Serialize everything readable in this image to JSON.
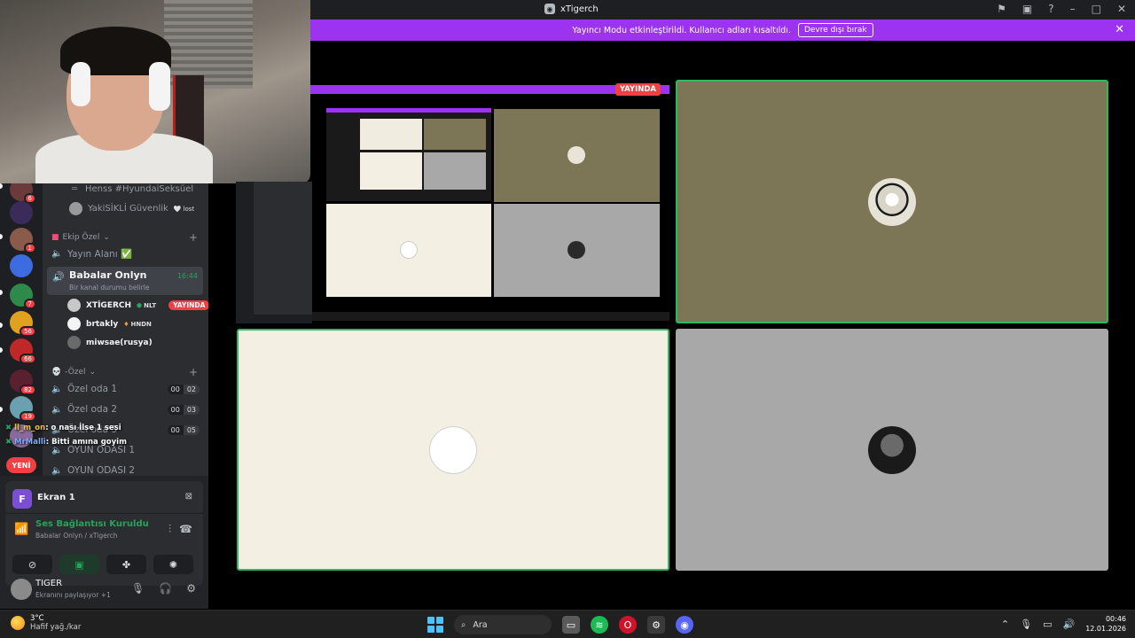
{
  "window": {
    "title": "xTigerch"
  },
  "banner": {
    "message": "Yayıncı Modu etkinleştirildi. Kullanıcı adları kısaltıldı.",
    "button": "Devre dışı bırak"
  },
  "rail": {
    "badges": [
      "6",
      "1",
      "7",
      "56",
      "66",
      "82",
      "19"
    ],
    "new_label": "YENİ"
  },
  "channels": {
    "top_items": [
      {
        "label": "Henss #HyundaiSeksüel"
      },
      {
        "label": "YakiSİKLİ Güvenlik",
        "tag": "lost"
      }
    ],
    "category1": "Ekip Özel",
    "yayin_alani": "Yayın Alanı ✅",
    "active": {
      "name": "Babalar Onlyn",
      "sub": "Bir kanal durumu belirle",
      "time": "16:44"
    },
    "users": [
      {
        "name": "XTİGERCH",
        "tag": "NLT",
        "live": "YAYINDA"
      },
      {
        "name": "brtakly",
        "tag": "HNDN"
      },
      {
        "name": "miwsae(rusya)"
      }
    ],
    "category2": "-Özel",
    "rooms": [
      {
        "name": "Özel oda 1",
        "a": "00",
        "b": "02"
      },
      {
        "name": "Özel oda 2",
        "a": "00",
        "b": "03"
      },
      {
        "name": "Özel oda 3",
        "a": "00",
        "b": "05"
      },
      {
        "name": "OYUN ODASI 1"
      },
      {
        "name": "OYUN ODASI 2"
      }
    ]
  },
  "chat": [
    {
      "user": "ll_m_on",
      "text": ": o nası İlse 1 sesi"
    },
    {
      "user": "MrMalli",
      "text": ": Bitti amına goyim"
    }
  ],
  "panel": {
    "screen_name": "Ekran 1",
    "screen_letter": "F",
    "voice_status": "Ses Bağlantısı Kuruldu",
    "voice_sub": "Babalar Onlyn / xTigerch",
    "user_name": "TIGER",
    "user_status": "Ekranını paylaşıyor +1"
  },
  "stage": {
    "live_label": "YAYINDA"
  },
  "taskbar": {
    "temp": "3°C",
    "weather": "Hafif yağ./kar",
    "search": "Ara",
    "time": "00:46",
    "date": "12.01.2026"
  },
  "colors": {
    "accent": "#9b33f0",
    "live": "#f23f43",
    "speaking": "#2dba5e",
    "tile_olive": "#7c7656",
    "tile_cream": "#f3f0e3",
    "tile_gray": "#a8a8a8"
  },
  "icons": [
    "flag-icon",
    "inbox-icon",
    "help-icon",
    "minimize-icon",
    "maximize-icon",
    "close-icon",
    "speaker-icon",
    "plus-icon",
    "signal-icon",
    "hangup-icon",
    "mic-icon",
    "headphones-icon",
    "gear-icon",
    "camera-off-icon",
    "screen-share-icon",
    "activity-icon",
    "soundboard-icon",
    "search-icon",
    "windows-icon"
  ]
}
